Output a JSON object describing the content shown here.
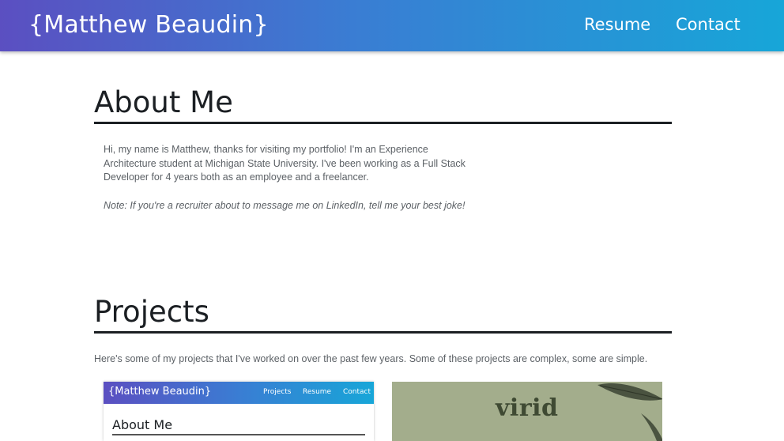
{
  "navbar": {
    "brand": "{Matthew Beaudin}",
    "links": [
      "Resume",
      "Contact"
    ]
  },
  "about": {
    "title": "About Me",
    "paragraph": "Hi, my name is Matthew, thanks for visiting my portfolio! I'm an Experience Architecture student at Michigan State University. I've been working as a Full Stack Developer for 4 years both as an employee and a freelancer.",
    "note": "Note: If you're a recruiter about to message me on LinkedIn, tell me your best joke!"
  },
  "projects": {
    "title": "Projects",
    "intro": "Here's some of my projects that I've worked on over the past few years. Some of these projects are complex, some are simple.",
    "cards": [
      {
        "brand": "{Matthew Beaudin}",
        "links": [
          "Projects",
          "Resume",
          "Contact"
        ],
        "heading": "About Me"
      },
      {
        "logo_text": "virid"
      }
    ]
  },
  "colors": {
    "navbar_gradient_start": "#5b4fc1",
    "navbar_gradient_end": "#17a6d8",
    "virid_background": "#a3ad8c"
  }
}
